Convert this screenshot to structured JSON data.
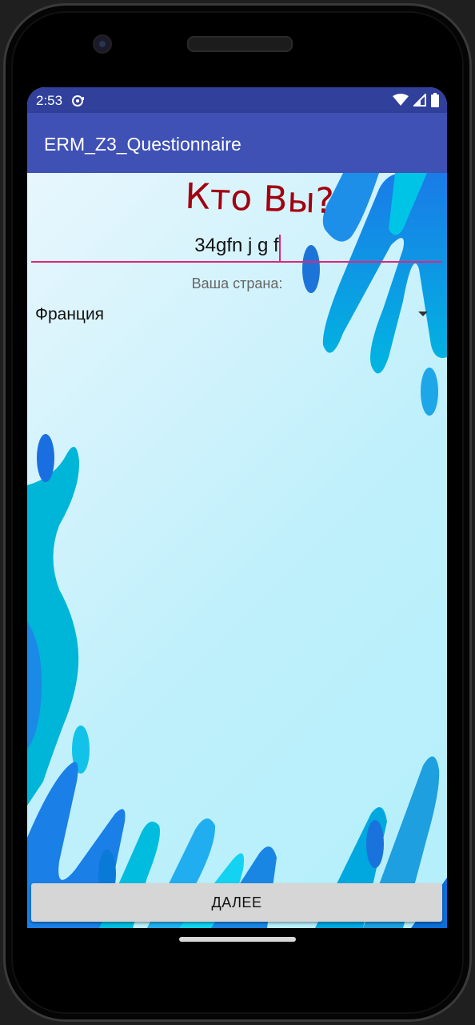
{
  "status_bar": {
    "time": "2:53",
    "icons": [
      "notification-icon",
      "wifi-icon",
      "signal-icon",
      "battery-icon"
    ]
  },
  "app_bar": {
    "title": "ERM_Z3_Questionnaire"
  },
  "form": {
    "heading": "Кто Вы?",
    "name_input_value": "34gfn j g f",
    "country_label": "Ваша страна:",
    "country_selected": "Франция"
  },
  "actions": {
    "next_label": "ДАЛЕЕ"
  },
  "colors": {
    "status_bar": "#30409b",
    "app_bar": "#3f51b5",
    "heading": "#a3000f",
    "accent": "#e0247e",
    "button": "#d6d6d6"
  }
}
